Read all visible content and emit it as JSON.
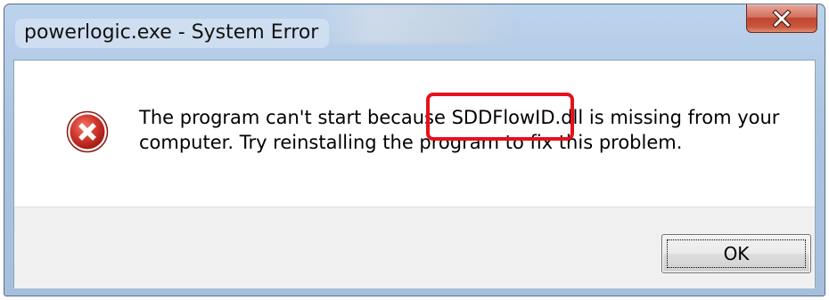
{
  "window": {
    "title": "powerlogic.exe - System Error"
  },
  "dialog": {
    "icon": "error-icon",
    "message_before": "The program can't start because ",
    "message_dll": "SDDFlowID.dll",
    "message_after": " is missing from your computer. Try reinstalling the program to fix this problem.",
    "ok_label": "OK"
  },
  "colors": {
    "highlight": "#e8101b",
    "error_red": "#c9302c",
    "close_button": "#c9553c"
  }
}
